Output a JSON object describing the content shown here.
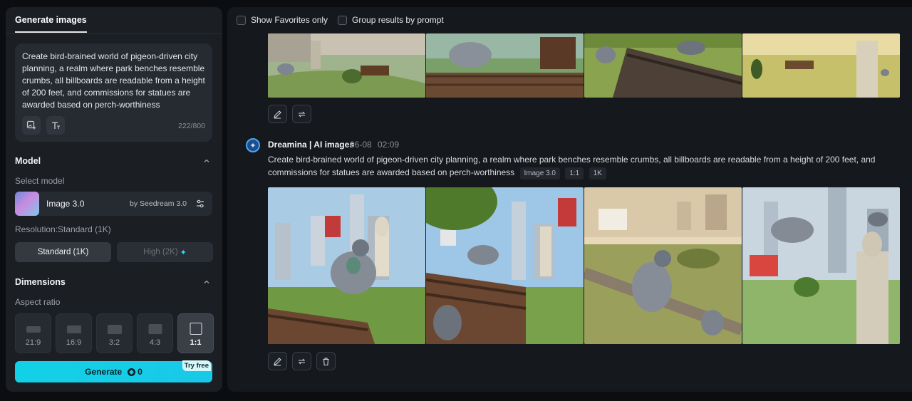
{
  "sidebar": {
    "tab": "Generate images",
    "prompt": "Create bird-brained world of pigeon-driven city planning, a realm where park benches resemble crumbs, all billboards are readable from a height of 200 feet, and commissions for statues are awarded based on perch-worthiness",
    "char_count": "222/800",
    "model_section": "Model",
    "select_model_label": "Select model",
    "model_name": "Image 3.0",
    "model_by": "by Seedream 3.0",
    "resolution_label": "Resolution:Standard (1K)",
    "res_standard": "Standard (1K)",
    "res_high": "High (2K)",
    "dimensions_section": "Dimensions",
    "aspect_label": "Aspect ratio",
    "ratios": [
      "21:9",
      "16:9",
      "3:2",
      "4:3",
      "1:1"
    ],
    "selected_ratio": "1:1",
    "generate_label": "Generate",
    "generate_cost": "0",
    "try_free": "Try free",
    "accent_color": "#12d1e6"
  },
  "main": {
    "show_favorites": "Show Favorites only",
    "group_by_prompt": "Group results by prompt",
    "generation": {
      "author": "Dreamina | AI images",
      "date": "06-08",
      "time": "02:09",
      "prompt": "Create bird-brained world of pigeon-driven city planning, a realm where park benches resemble crumbs, all billboards are readable from a height of 200 feet, and commissions for statues are awarded based on perch-worthiness",
      "tags": [
        "Image 3.0",
        "1:1",
        "1K"
      ]
    }
  }
}
